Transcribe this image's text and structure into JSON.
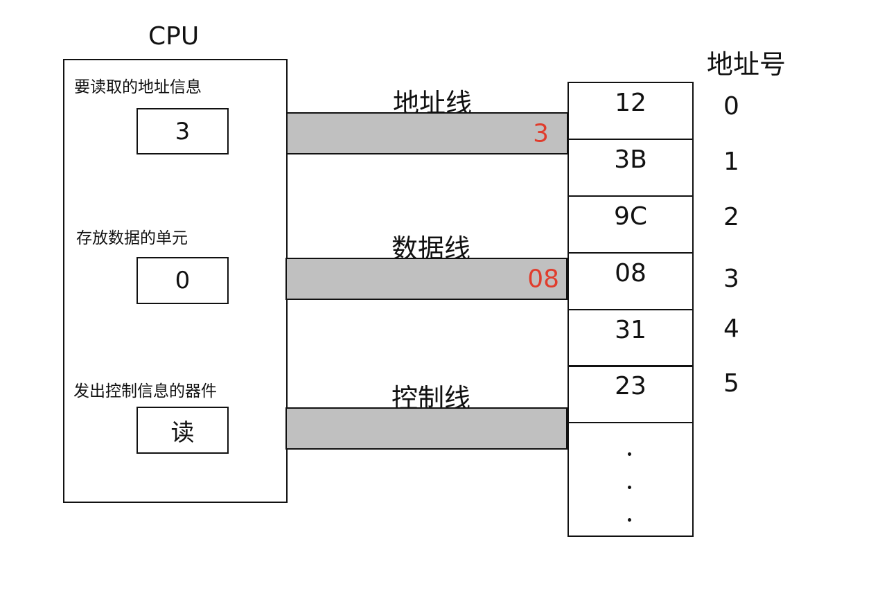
{
  "cpu": {
    "title": "CPU",
    "address_info_label": "要读取的地址信息",
    "address_info_value": "3",
    "data_unit_label": "存放数据的单元",
    "data_unit_value": "0",
    "control_label": "发出控制信息的器件",
    "control_value": "读"
  },
  "buses": {
    "address": {
      "label": "地址线",
      "value": "3"
    },
    "data": {
      "label": "数据线",
      "value": "08"
    },
    "control": {
      "label": "控制线"
    }
  },
  "memory": {
    "address_header": "地址号",
    "cells": [
      {
        "value": "12",
        "address": "0"
      },
      {
        "value": "3B",
        "address": "1"
      },
      {
        "value": "9C",
        "address": "2"
      },
      {
        "value": "08",
        "address": "3"
      },
      {
        "value": "31",
        "address": "4"
      },
      {
        "value": "23",
        "address": "5"
      }
    ],
    "ellipsis": "..."
  },
  "colors": {
    "bus_fill": "#c0c0c0",
    "highlight": "#e03c2c"
  }
}
